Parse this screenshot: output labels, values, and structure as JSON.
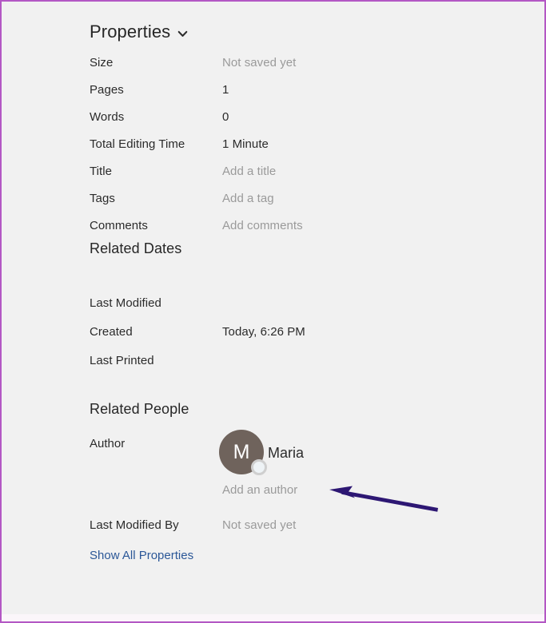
{
  "panel": {
    "title": "Properties",
    "chevron_icon": "chevron-down-icon"
  },
  "properties": [
    {
      "label": "Size",
      "value": "Not saved yet",
      "placeholder": true
    },
    {
      "label": "Pages",
      "value": "1",
      "placeholder": false
    },
    {
      "label": "Words",
      "value": "0",
      "placeholder": false
    },
    {
      "label": "Total Editing Time",
      "value": "1 Minute",
      "placeholder": false
    },
    {
      "label": "Title",
      "value": "Add a title",
      "placeholder": true
    },
    {
      "label": "Tags",
      "value": "Add a tag",
      "placeholder": true
    },
    {
      "label": "Comments",
      "value": "Add comments",
      "placeholder": true
    }
  ],
  "related_dates": {
    "heading": "Related Dates",
    "rows": [
      {
        "label": "Last Modified",
        "value": "",
        "placeholder": false
      },
      {
        "label": "Created",
        "value": "Today, 6:26 PM",
        "placeholder": false
      },
      {
        "label": "Last Printed",
        "value": "",
        "placeholder": false
      }
    ]
  },
  "related_people": {
    "heading": "Related People",
    "author_label": "Author",
    "author_name": "Maria",
    "author_initial": "M",
    "add_author_placeholder": "Add an author",
    "last_modified_by_label": "Last Modified By",
    "last_modified_by_value": "Not saved yet"
  },
  "footer": {
    "show_all_properties": "Show All Properties"
  },
  "colors": {
    "background": "#f1f1f1",
    "border": "#b357c4",
    "link": "#2b5797",
    "placeholder_text": "#9a9a9a",
    "primary_text": "#2b2b2b",
    "avatar_background": "#6f635c",
    "annotation_arrow": "#2d1773"
  }
}
